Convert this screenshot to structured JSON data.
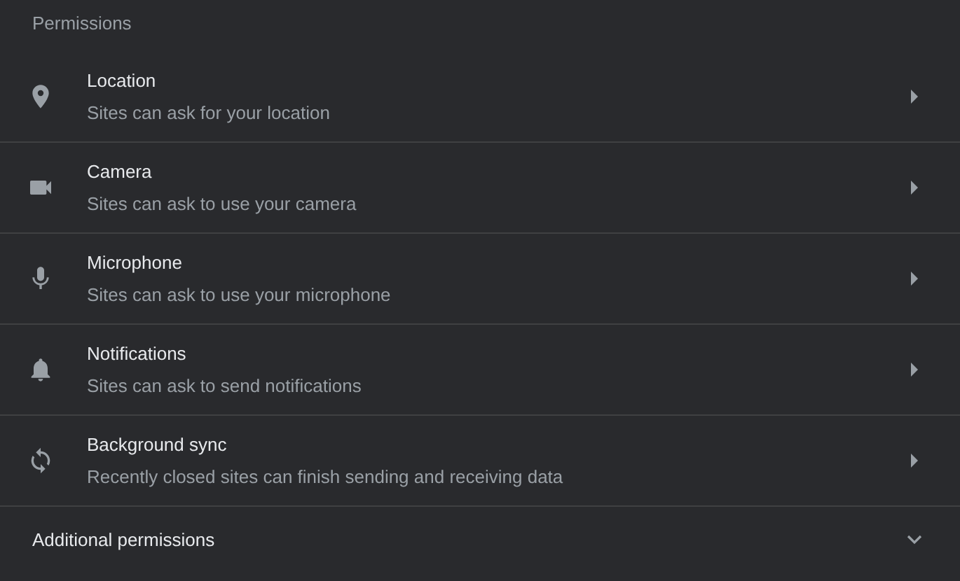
{
  "section_title": "Permissions",
  "items": [
    {
      "title": "Location",
      "subtitle": "Sites can ask for your location"
    },
    {
      "title": "Camera",
      "subtitle": "Sites can ask to use your camera"
    },
    {
      "title": "Microphone",
      "subtitle": "Sites can ask to use your microphone"
    },
    {
      "title": "Notifications",
      "subtitle": "Sites can ask to send notifications"
    },
    {
      "title": "Background sync",
      "subtitle": "Recently closed sites can finish sending and receiving data"
    }
  ],
  "additional": {
    "label": "Additional permissions",
    "expanded": false
  }
}
